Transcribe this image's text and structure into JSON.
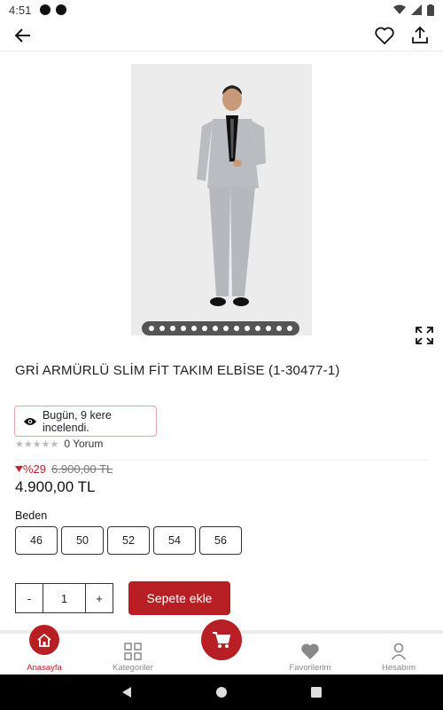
{
  "status_bar": {
    "time": "4:51",
    "icons": [
      "wifi-icon",
      "signal-icon",
      "battery-icon"
    ]
  },
  "app_bar": {
    "icons": [
      "back-arrow-icon",
      "heart-icon",
      "share-icon"
    ]
  },
  "product": {
    "title": "GRİ ARMÜRLÜ SLİM FİT TAKIM ELBİSE (1-30477-1)",
    "views_text": "Bugün, 9 kere incelendi.",
    "reviews_text": "0 Yorum",
    "discount": "%29",
    "old_price": "6.900,00 TL",
    "price": "4.900,00 TL",
    "image_count": 14
  },
  "size": {
    "label": "Beden",
    "options": [
      "46",
      "50",
      "52",
      "54",
      "56"
    ]
  },
  "cart": {
    "qty_minus": "-",
    "quantity": "1",
    "qty_plus": "+",
    "add_label": "Sepete ekle"
  },
  "bottom_nav": {
    "home": "Anasayfa",
    "categories": "Kategoriler",
    "favorites": "Favorilerim",
    "account": "Hesabım"
  },
  "colors": {
    "brand": "#b81f24",
    "text": "#222222"
  }
}
